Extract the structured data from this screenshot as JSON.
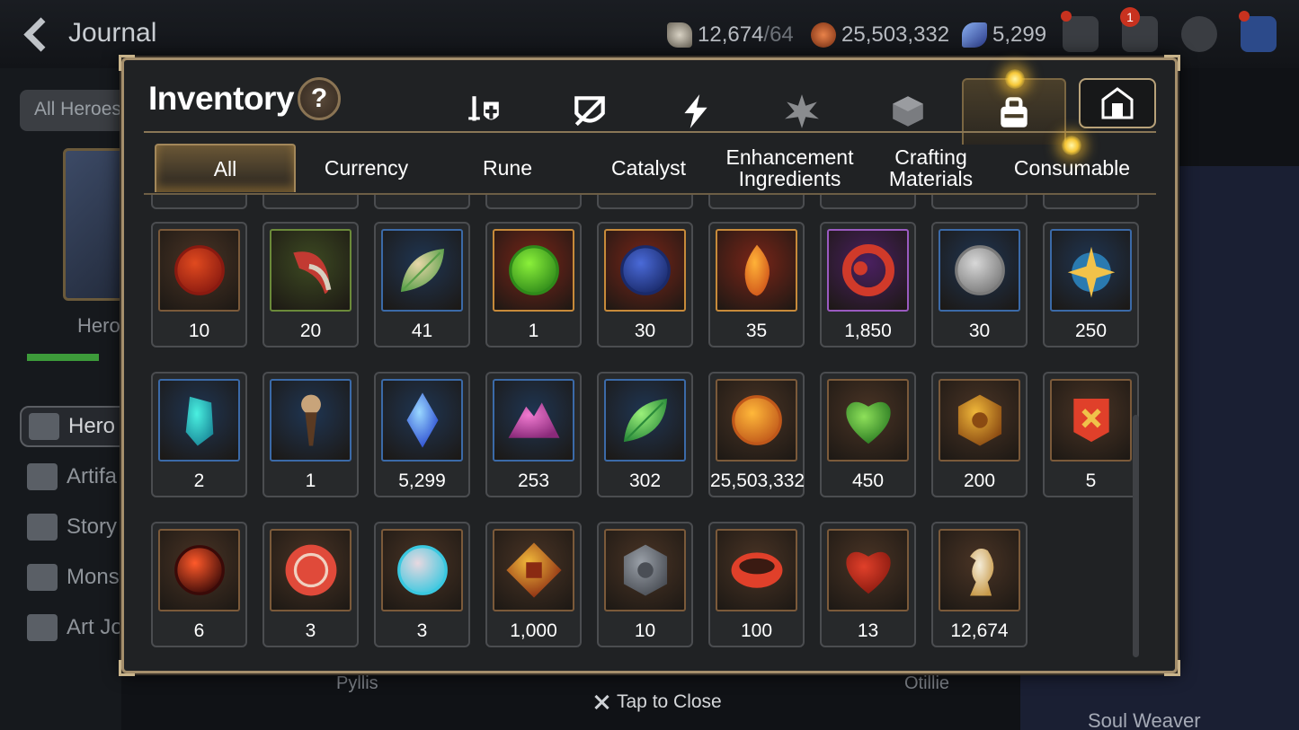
{
  "header": {
    "title": "Journal",
    "stamina": "12,674",
    "stamina_max": "/64",
    "gold": "25,503,332",
    "crystals": "5,299",
    "mail_badge": "1"
  },
  "background": {
    "filter_label": "All Heroes",
    "hero_label": "Hero",
    "menu": [
      "Hero J",
      "Artifa",
      "Story",
      "Monst",
      "Art Jo"
    ],
    "names": [
      "Pyllis",
      "Otillie"
    ],
    "soul_weaver": "Soul Weaver",
    "tap_to_close": "Tap to Close"
  },
  "inventory": {
    "title": "Inventory",
    "help": "?",
    "type_tabs": [
      "weapon-icon",
      "armor-icon",
      "skill-icon",
      "artifact-icon",
      "cube-icon",
      "bag-icon"
    ],
    "categories": [
      {
        "label": "All",
        "active": true
      },
      {
        "label": "Currency"
      },
      {
        "label": "Rune"
      },
      {
        "label": "Catalyst"
      },
      {
        "label": "Enhancement Ingredients"
      },
      {
        "label": "Crafting Materials"
      },
      {
        "label": "Consumable"
      }
    ],
    "rows": [
      [
        {
          "count": "10",
          "icon": "red-orb",
          "frame": "#7b5a3a",
          "bg": "#4a3425",
          "c1": "#e04a1f",
          "c2": "#8a1a10",
          "shape": "circle"
        },
        {
          "count": "20",
          "icon": "claw",
          "frame": "#6b8a3a",
          "bg": "#3d4a22",
          "c1": "#c23a32",
          "c2": "#5a3128",
          "shape": "claw"
        },
        {
          "count": "41",
          "icon": "herb-root",
          "frame": "#3b6aa8",
          "bg": "#1f3552",
          "c1": "#e8d6a8",
          "c2": "#5aa04a",
          "shape": "leaf"
        },
        {
          "count": "1",
          "icon": "green-gem",
          "frame": "#c78a3a",
          "bg": "#7a2518",
          "c1": "#8bf03a",
          "c2": "#2f8a1a",
          "shape": "circle"
        },
        {
          "count": "30",
          "icon": "blue-charm",
          "frame": "#c78a3a",
          "bg": "#7a2518",
          "c1": "#4a6ad8",
          "c2": "#1a2a6a",
          "shape": "circle"
        },
        {
          "count": "35",
          "icon": "flame-crystal",
          "frame": "#c78a3a",
          "bg": "#7a2518",
          "c1": "#ffb238",
          "c2": "#d0561a",
          "shape": "flame"
        },
        {
          "count": "1,850",
          "icon": "red-ring",
          "frame": "#9a5ac0",
          "bg": "#4a2060",
          "c1": "#d03a2a",
          "c2": "#3a1010",
          "shape": "ring"
        },
        {
          "count": "30",
          "icon": "silver-coin",
          "frame": "#3b6aa8",
          "bg": "#1f3552",
          "c1": "#d8d8d8",
          "c2": "#7a7a7a",
          "shape": "circle"
        },
        {
          "count": "250",
          "icon": "star-pendant",
          "frame": "#3b6aa8",
          "bg": "#1f3552",
          "c1": "#f2c24a",
          "c2": "#2a7ab0",
          "shape": "star"
        }
      ],
      [
        {
          "count": "2",
          "icon": "cyan-crystal",
          "frame": "#3b6aa8",
          "bg": "#1f3552",
          "c1": "#4af0e0",
          "c2": "#1a8a9a",
          "shape": "crystal"
        },
        {
          "count": "1",
          "icon": "key-charm",
          "frame": "#3b6aa8",
          "bg": "#1f3552",
          "c1": "#c8a47a",
          "c2": "#5a3a22",
          "shape": "key"
        },
        {
          "count": "5,299",
          "icon": "blue-diamond",
          "frame": "#3b6aa8",
          "bg": "#1f3552",
          "c1": "#9ad8ff",
          "c2": "#2a4ad0",
          "shape": "diamond"
        },
        {
          "count": "253",
          "icon": "pink-mountain",
          "frame": "#3b6aa8",
          "bg": "#1f3552",
          "c1": "#f07ad0",
          "c2": "#8a2a7a",
          "shape": "mountain"
        },
        {
          "count": "302",
          "icon": "green-leaf",
          "frame": "#3b6aa8",
          "bg": "#1f3552",
          "c1": "#9af07a",
          "c2": "#2a8a3a",
          "shape": "leaf"
        },
        {
          "count": "25,503,332",
          "icon": "gold-coin",
          "frame": "#7b5a3a",
          "bg": "#4a3425",
          "c1": "#ffb83a",
          "c2": "#c0581a",
          "shape": "circle"
        },
        {
          "count": "450",
          "icon": "green-heart",
          "frame": "#7b5a3a",
          "bg": "#4a3425",
          "c1": "#8ee05a",
          "c2": "#2a7a22",
          "shape": "heart"
        },
        {
          "count": "200",
          "icon": "gold-emblem",
          "frame": "#7b5a3a",
          "bg": "#4a3425",
          "c1": "#f0b83a",
          "c2": "#8a4a12",
          "shape": "hex"
        },
        {
          "count": "5",
          "icon": "red-banner",
          "frame": "#7b5a3a",
          "bg": "#4a3425",
          "c1": "#e0402a",
          "c2": "#f0c24a",
          "shape": "banner"
        }
      ],
      [
        {
          "count": "6",
          "icon": "lava-orb",
          "frame": "#7b5a3a",
          "bg": "#4a3425",
          "c1": "#ff5a2a",
          "c2": "#3a0a08",
          "shape": "circle"
        },
        {
          "count": "3",
          "icon": "red-seal",
          "frame": "#7b5a3a",
          "bg": "#4a3425",
          "c1": "#e04a3a",
          "c2": "#f0d0c0",
          "shape": "seal"
        },
        {
          "count": "3",
          "icon": "robot-pet",
          "frame": "#7b5a3a",
          "bg": "#4a3425",
          "c1": "#e8d8e0",
          "c2": "#3ac8e0",
          "shape": "circle"
        },
        {
          "count": "1,000",
          "icon": "fist-emblem",
          "frame": "#7b5a3a",
          "bg": "#4a3425",
          "c1": "#f0b83a",
          "c2": "#8a2a12",
          "shape": "diamondbadge"
        },
        {
          "count": "10",
          "icon": "stone-compass",
          "frame": "#7b5a3a",
          "bg": "#4a3425",
          "c1": "#9aa0a8",
          "c2": "#4a4e55",
          "shape": "hex"
        },
        {
          "count": "100",
          "icon": "red-band",
          "frame": "#7b5a3a",
          "bg": "#4a3425",
          "c1": "#e0402a",
          "c2": "#f0c24a",
          "shape": "band"
        },
        {
          "count": "13",
          "icon": "red-petals",
          "frame": "#7b5a3a",
          "bg": "#4a3425",
          "c1": "#e0402a",
          "c2": "#8a1a10",
          "shape": "heart"
        },
        {
          "count": "12,674",
          "icon": "stamina-horse",
          "frame": "#7b5a3a",
          "bg": "#4a3425",
          "c1": "#f4ecd8",
          "c2": "#c89a4a",
          "shape": "horse"
        }
      ]
    ]
  }
}
